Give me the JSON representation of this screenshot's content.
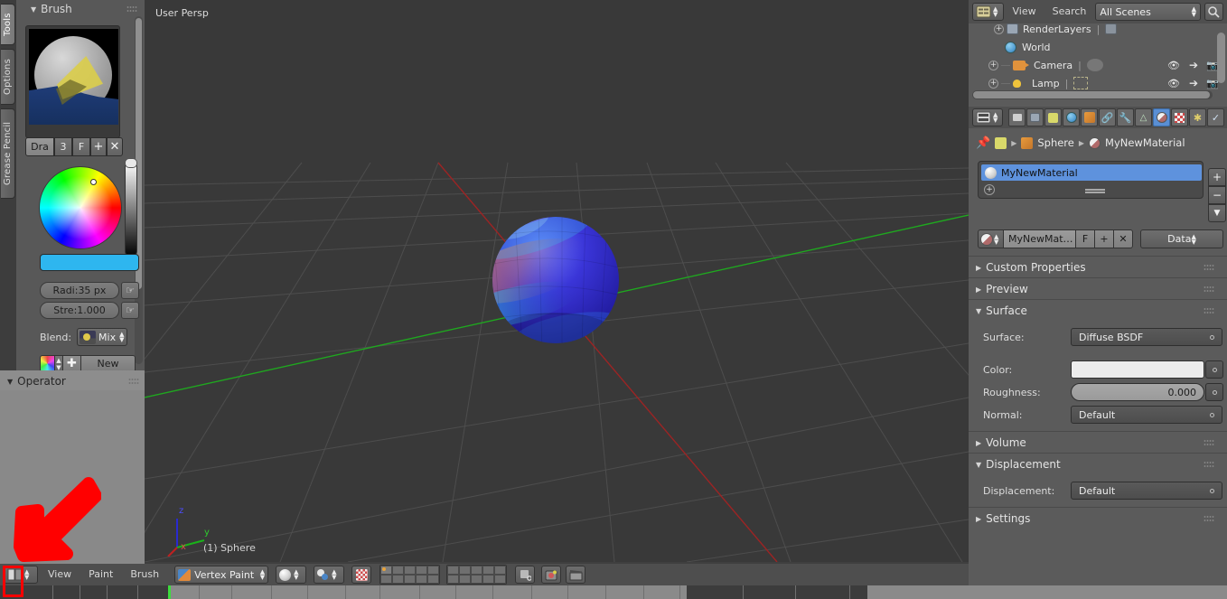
{
  "app": {
    "name": "Blender",
    "theme_bg": "#3f3f3f",
    "accent": "#5e92dd",
    "annotation_color": "#ff0000"
  },
  "left_tabs": [
    {
      "label": "Tools",
      "active": true
    },
    {
      "label": "Options",
      "active": false
    },
    {
      "label": "Grease Pencil",
      "active": false
    }
  ],
  "brush_panel": {
    "title": "Brush",
    "preview_icon": "brush-preview-thumbnail",
    "datablock": {
      "name": "Dra",
      "users": "3",
      "fake_user": "F",
      "new_icon": "+",
      "unlink_icon": "✕"
    },
    "color_wheel_icon": "color-wheel",
    "value_slider_icon": "value-slider",
    "color_swatch": "#2eb6ef",
    "radius": {
      "label": "Radi:",
      "value": "35 px",
      "anim_icon": "animate-property"
    },
    "strength": {
      "label": "Stre:",
      "value": "1.000",
      "anim_icon": "animate-property"
    },
    "blend": {
      "label": "Blend:",
      "value": "Mix"
    },
    "texture": {
      "new_label": "New",
      "icon": "texture-datablock"
    }
  },
  "operator_panel": {
    "title": "Operator"
  },
  "viewport": {
    "view_name": "User Persp",
    "object_info": "(1) Sphere",
    "axes": {
      "x": "x",
      "y": "y",
      "z": "z",
      "x_color": "#cc2222",
      "y_color": "#22bb22",
      "z_color": "#2222cc"
    },
    "bg_color": "#393939",
    "grid_color": "#4f4f4f"
  },
  "outliner": {
    "editor_type_icon": "outliner-editor-icon",
    "menus": [
      "View",
      "Search"
    ],
    "scene_filter": "All Scenes",
    "search_icon": "search-icon",
    "rows": [
      {
        "name": "RenderLayers",
        "icon": "renderlayers-icon",
        "expandable": true,
        "has_data_icon": true,
        "eye": false,
        "cursor": false,
        "camera": false
      },
      {
        "name": "World",
        "icon": "world-icon",
        "expandable": false,
        "has_data_icon": false,
        "eye": false,
        "cursor": false,
        "camera": false
      },
      {
        "name": "Camera",
        "icon": "camera-icon",
        "expandable": true,
        "has_data_icon": true,
        "eye": true,
        "cursor": true,
        "camera": true
      },
      {
        "name": "Lamp",
        "icon": "lamp-icon",
        "expandable": true,
        "has_data_icon": true,
        "eye": true,
        "cursor": true,
        "camera": true
      }
    ]
  },
  "properties": {
    "editor_type_icon": "properties-editor-icon",
    "tabs": [
      {
        "name": "render-tab",
        "icon": "camera-back-icon",
        "active": false
      },
      {
        "name": "render-layers-tab",
        "icon": "images-icon",
        "active": false
      },
      {
        "name": "scene-tab",
        "icon": "scene-icon",
        "active": false
      },
      {
        "name": "world-tab",
        "icon": "world-icon",
        "active": false
      },
      {
        "name": "object-tab",
        "icon": "cube-icon",
        "active": false
      },
      {
        "name": "constraints-tab",
        "icon": "chain-icon",
        "active": false
      },
      {
        "name": "modifiers-tab",
        "icon": "wrench-icon",
        "active": false
      },
      {
        "name": "data-tab",
        "icon": "triangle-mesh-icon",
        "active": false
      },
      {
        "name": "material-tab",
        "icon": "material-ball-icon",
        "active": true
      },
      {
        "name": "texture-tab",
        "icon": "checker-icon",
        "active": false
      },
      {
        "name": "particles-tab",
        "icon": "particles-icon",
        "active": false
      },
      {
        "name": "physics-tab",
        "icon": "physics-icon",
        "active": false
      }
    ],
    "breadcrumb": {
      "pin_icon": "pin-icon",
      "scene_icon": "scene-icon",
      "object": "Sphere",
      "material": "MyNewMaterial"
    },
    "material_slots": {
      "selected": "MyNewMaterial",
      "add_icon": "+",
      "remove_icon": "−",
      "specials_icon": "▼"
    },
    "datablock_row": {
      "name": "MyNewMat…",
      "fake_user": "F",
      "new_icon": "+",
      "unlink_icon": "✕",
      "link_mode": "Data"
    },
    "sections": [
      {
        "label": "Custom Properties",
        "open": false
      },
      {
        "label": "Preview",
        "open": false
      },
      {
        "label": "Surface",
        "open": true
      },
      {
        "label": "Volume",
        "open": false
      },
      {
        "label": "Displacement",
        "open": true
      },
      {
        "label": "Settings",
        "open": false
      }
    ],
    "surface": {
      "surface_label": "Surface:",
      "surface_value": "Diffuse BSDF",
      "color_label": "Color:",
      "color_value": "#ececec",
      "roughness_label": "Roughness:",
      "roughness_value": "0.000",
      "normal_label": "Normal:",
      "normal_value": "Default"
    },
    "displacement": {
      "label": "Displacement:",
      "value": "Default"
    }
  },
  "view3d_header": {
    "editor_type_icon": "view3d-editor-icon",
    "menus": [
      "View",
      "Paint",
      "Brush"
    ],
    "mode": "Vertex Paint",
    "shading": "solid-shading",
    "pivot": "pivot-median-point",
    "snap_icon": "snap-magnet-icon",
    "layers_note": "scene-layers",
    "manipulator_icon": "manipulator-icon",
    "render_icon": "render-preview-icon",
    "ruler_icon": "clapperboard-icon"
  },
  "annotation": {
    "arrow": "red-arrow-pointing-to-editor-type-selector",
    "highlight_box": "red-rectangle-around-editor-type-button"
  },
  "timeline": {
    "playhead_frame_marker": "green-playhead"
  }
}
